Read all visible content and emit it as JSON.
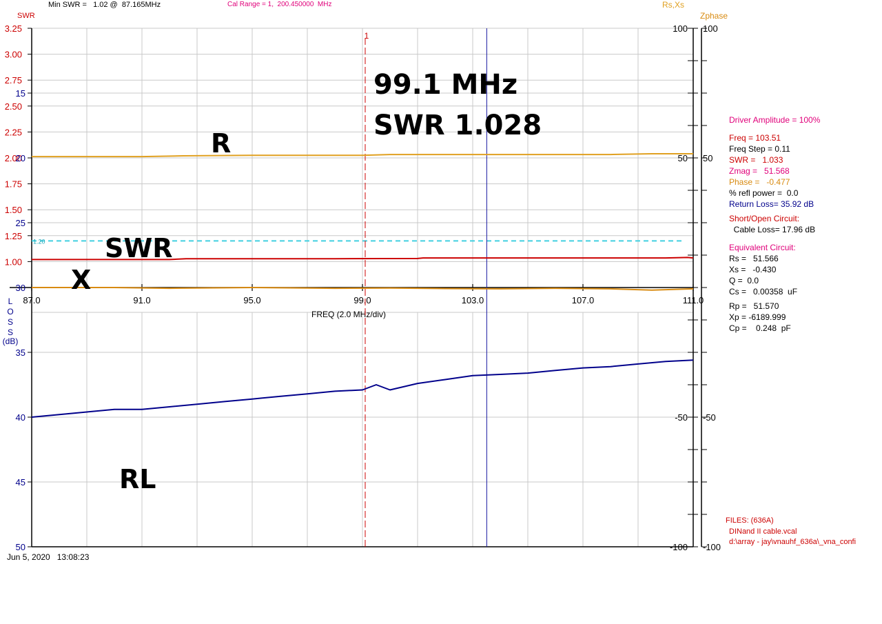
{
  "header": {
    "swr_axis_title": "SWR",
    "min_swr": "Min SWR =   1.02 @  87.165MHz",
    "cal_range": "Cal Range = 1,  200.450000  MHz",
    "rs_xs_title": "Rs,Xs",
    "zphase_title": "Zphase"
  },
  "side_panel": {
    "driver_amplitude": "Driver Amplitude = 100%",
    "freq": "Freq = 103.51",
    "freq_step": "Freq Step = 0.11",
    "swr": "SWR =   1.033",
    "zmag": "Zmag =   51.568",
    "phase": "Phase =   -0.477",
    "refl_power": "% refl power =  0.0",
    "return_loss": "Return Loss= 35.92 dB",
    "short_open_title": "Short/Open Circuit:",
    "cable_loss": "  Cable Loss= 17.96 dB",
    "equiv_title": "Equivalent Circuit:",
    "rs": "Rs =   51.566",
    "xs": "Xs =   -0.430",
    "q": "Q =  0.0",
    "cs": "Cs =   0.00358  uF",
    "rp": "Rp =   51.570",
    "xp": "Xp = -6189.999",
    "cp": "Cp =    0.248  pF",
    "files_title": "FILES: (636A)",
    "file_cal": "DINand II cable.vcal",
    "file_path": "d:\\array - jay\\vnauhf_636a\\_vna_confi"
  },
  "footer": {
    "timestamp": "Jun 5, 2020   13:08:23"
  },
  "annotations": {
    "freq": "99.1 MHz",
    "swr": "SWR 1.028",
    "r": "R",
    "swr_trace": "SWR",
    "x": "X",
    "rl": "RL"
  },
  "colors": {
    "swr": "#cc0000",
    "r": "#e0a020",
    "x": "#d88a10",
    "rl": "#00008b",
    "ref_line": "#40d0e0",
    "grid": "#c8c8c8",
    "marker": "#cc0000",
    "cursor": "#1a1aa0",
    "pink": "#e0007a",
    "side_red": "#cc0000"
  },
  "chart_data": {
    "type": "line",
    "xlabel": "FREQ (2.0 MHz/div)",
    "x_ticks": [
      "87.0",
      "91.0",
      "95.0",
      "99.0",
      "103.0",
      "107.0",
      "111.0"
    ],
    "x_range": [
      87.0,
      111.0
    ],
    "swr_axis": {
      "label": "SWR",
      "range": [
        0.75,
        3.25
      ],
      "ticks": [
        "3.25",
        "3.00",
        "2.75",
        "2.50",
        "2.25",
        "2.00",
        "1.75",
        "1.50",
        "1.25",
        "1.00"
      ]
    },
    "loss_axis": {
      "label": [
        "L",
        "O",
        "S",
        "S",
        "(dB)"
      ],
      "range": [
        10,
        50
      ],
      "ticks": [
        "15",
        "20",
        "25",
        "30",
        "35",
        "40",
        "45",
        "50"
      ]
    },
    "right_axis": {
      "range": [
        -100,
        100
      ],
      "inner_ticks": [
        "100",
        "50",
        "-50",
        "-100"
      ],
      "outer_ticks": [
        "100",
        "50",
        "-50",
        "-100"
      ]
    },
    "reference_line": {
      "label": "1.20",
      "value": 1.2
    },
    "marker": {
      "label": "1",
      "x": 99.1
    },
    "cursor": {
      "x": 103.51
    },
    "series": [
      {
        "name": "SWR",
        "axis": "swr",
        "x": [
          87.0,
          90.0,
          92.0,
          92.6,
          95.0,
          98.0,
          101.0,
          101.2,
          104.0,
          108.0,
          110.0,
          110.8,
          111.0
        ],
        "values": [
          1.02,
          1.02,
          1.02,
          1.028,
          1.028,
          1.028,
          1.03,
          1.035,
          1.035,
          1.035,
          1.035,
          1.04,
          1.035
        ]
      },
      {
        "name": "R",
        "axis": "right",
        "x": [
          87.0,
          91.0,
          92.5,
          95.0,
          99.0,
          100.0,
          102.0,
          105.0,
          108.0,
          109.5,
          111.0
        ],
        "values": [
          50.5,
          50.5,
          50.8,
          51.0,
          51.0,
          51.3,
          51.3,
          51.3,
          51.3,
          51.6,
          51.6
        ]
      },
      {
        "name": "X",
        "axis": "right",
        "x": [
          87.0,
          90.0,
          92.0,
          95.0,
          98.0,
          100.0,
          102.0,
          104.0,
          106.0,
          108.0,
          109.5,
          111.0
        ],
        "values": [
          0.0,
          0.0,
          -0.3,
          0.0,
          -0.3,
          -0.2,
          -0.4,
          -0.5,
          -0.3,
          -0.5,
          -1.0,
          -0.5
        ]
      },
      {
        "name": "RL",
        "axis": "loss",
        "x": [
          87.0,
          88.0,
          89.0,
          90.0,
          91.0,
          92.0,
          93.0,
          94.0,
          95.0,
          96.0,
          97.0,
          98.0,
          99.0,
          99.5,
          100.0,
          101.0,
          102.0,
          103.0,
          104.0,
          105.0,
          106.0,
          107.0,
          108.0,
          109.0,
          110.0,
          111.0
        ],
        "values": [
          40.0,
          39.8,
          39.6,
          39.4,
          39.4,
          39.2,
          39.0,
          38.8,
          38.6,
          38.4,
          38.2,
          38.0,
          37.9,
          37.5,
          37.9,
          37.4,
          37.1,
          36.8,
          36.7,
          36.6,
          36.4,
          36.2,
          36.1,
          35.9,
          35.7,
          35.6
        ]
      }
    ]
  }
}
